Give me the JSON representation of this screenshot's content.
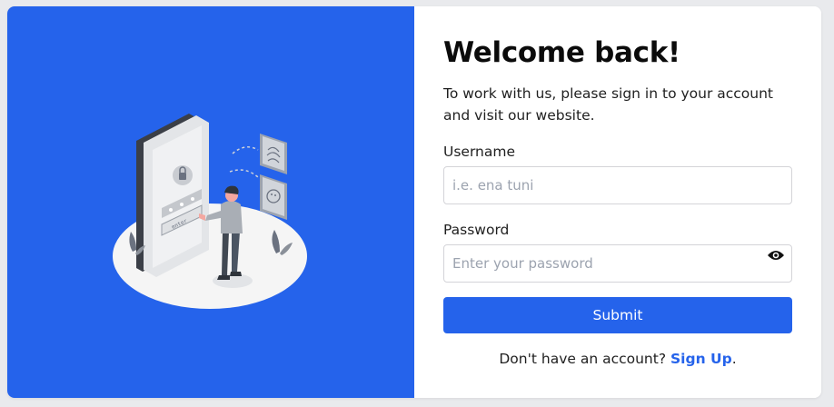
{
  "login": {
    "title": "Welcome back!",
    "subtitle": "To work with us, please sign in to your account and visit our website.",
    "username_label": "Username",
    "username_placeholder": "i.e. ena tuni",
    "password_label": "Password",
    "password_placeholder": "Enter your password",
    "submit_label": "Submit",
    "signup_prompt": "Don't have an account?",
    "signup_link": "Sign Up",
    "signup_suffix": "."
  },
  "illustration": {
    "keypad_text": "enter"
  },
  "icons": {
    "password_toggle": "eye-icon"
  },
  "colors": {
    "accent": "#2563eb",
    "page_background": "#e9eaed",
    "card_background": "#ffffff"
  }
}
